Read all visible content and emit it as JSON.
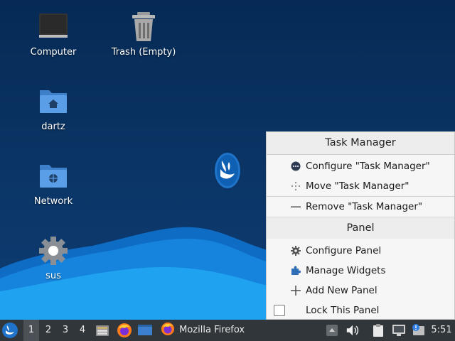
{
  "desktop": {
    "icons": [
      {
        "label": "Computer",
        "icon": "computer-icon"
      },
      {
        "label": "Trash (Empty)",
        "icon": "trash-icon"
      },
      {
        "label": "dartz",
        "icon": "home-folder-icon"
      },
      {
        "label": "Network",
        "icon": "network-folder-icon"
      },
      {
        "label": "sus",
        "icon": "gear-icon"
      }
    ]
  },
  "context_menu": {
    "header_task_manager": "Task Manager",
    "configure_task_manager": "Configure \"Task Manager\"",
    "move_task_manager": "Move \"Task Manager\"",
    "remove_task_manager": "Remove \"Task Manager\"",
    "header_panel": "Panel",
    "configure_panel": "Configure Panel",
    "manage_widgets": "Manage Widgets",
    "add_new_panel": "Add New Panel",
    "lock_this_panel": "Lock This Panel",
    "lock_checked": false
  },
  "taskbar": {
    "workspaces": [
      "1",
      "2",
      "3",
      "4"
    ],
    "active_workspace": "1",
    "window_title": "Mozilla Firefox",
    "clock": "5:51"
  },
  "colors": {
    "desktop_bg": "#0b3566",
    "wave_light": "#1fa2f0",
    "taskbar_bg": "#31363b",
    "menu_bg": "#f6f6f6"
  }
}
